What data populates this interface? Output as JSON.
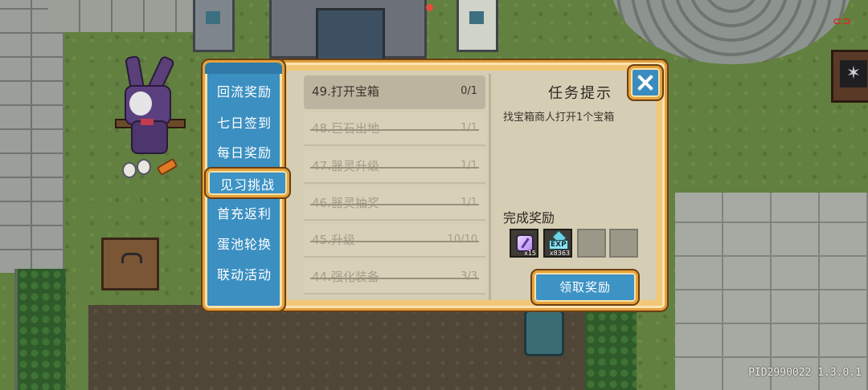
{
  "tabs": [
    {
      "label": "回流奖励",
      "active": false
    },
    {
      "label": "七日签到",
      "active": false
    },
    {
      "label": "每日奖励",
      "active": false
    },
    {
      "label": "见习挑战",
      "active": true
    },
    {
      "label": "首充返利",
      "active": false
    },
    {
      "label": "蛋池轮换",
      "active": false
    },
    {
      "label": "联动活动",
      "active": false
    }
  ],
  "tasks": [
    {
      "name": "49.打开宝箱",
      "progress": "0/1",
      "completed": false
    },
    {
      "name": "48.巨石出地",
      "progress": "1/1",
      "completed": true
    },
    {
      "name": "47.器灵升级",
      "progress": "1/1",
      "completed": true
    },
    {
      "name": "46.器灵抽奖",
      "progress": "1/1",
      "completed": true
    },
    {
      "name": "45.升级",
      "progress": "10/10",
      "completed": true
    },
    {
      "name": "44.强化装备",
      "progress": "3/3",
      "completed": true
    }
  ],
  "hint": {
    "title": "任务提示",
    "text": "找宝箱商人打开1个宝箱"
  },
  "rewards": {
    "title": "完成奖励",
    "items": [
      {
        "icon": "gem-icon",
        "qty": "x15"
      },
      {
        "icon": "exp-icon",
        "label": "EXP",
        "qty": "x8363"
      },
      {
        "icon": "empty-slot",
        "qty": ""
      },
      {
        "icon": "empty-slot",
        "qty": ""
      }
    ]
  },
  "buttons": {
    "claim_label": "领取奖励",
    "close_icon": "close-icon"
  },
  "version_text": "PID2990022 1.3.0.1",
  "colors": {
    "tab_blue": "#3b8fc1",
    "frame_gold": "#e6a23a",
    "panel_bg": "#d6cdb5"
  }
}
